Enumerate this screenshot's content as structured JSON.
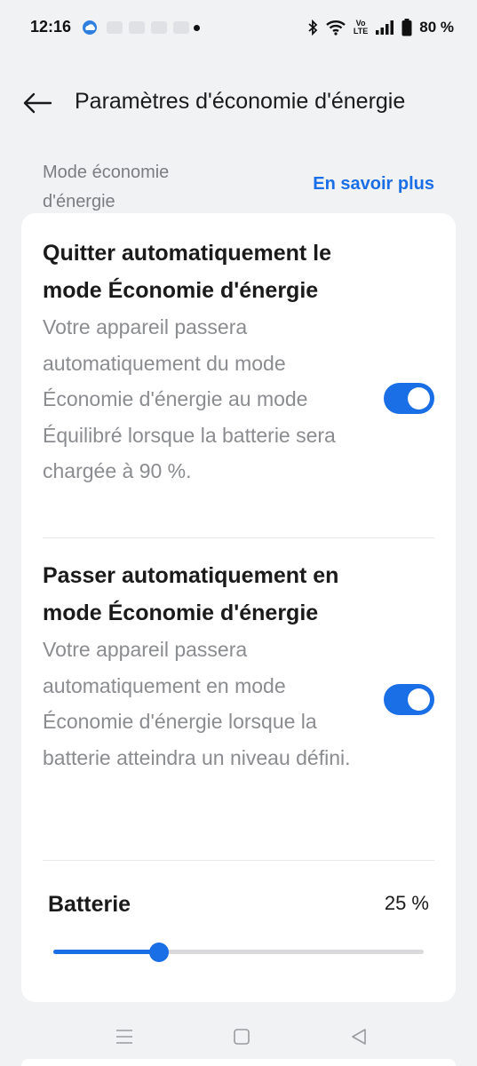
{
  "status_bar": {
    "time": "12:16",
    "volte_top": "Vo",
    "volte_bottom": "LTE",
    "battery_percent": "80 %",
    "icons": [
      "weather-icon",
      "bluetooth-icon",
      "wifi-icon",
      "signal-icon",
      "battery-icon"
    ]
  },
  "header": {
    "title": "Paramètres d'économie d'énergie"
  },
  "section": {
    "label": "Mode économie d'énergie",
    "link": "En savoir plus"
  },
  "settings": [
    {
      "title": "Quitter automatiquement le mode Économie d'énergie",
      "description": "Votre appareil passera automatiquement du mode Économie d'énergie au mode Équilibré lorsque la batterie sera chargée à 90 %.",
      "enabled": true
    },
    {
      "title": "Passer automatiquement en mode Économie d'énergie",
      "description": "Votre appareil passera automatiquement en mode Économie d'énergie lorsque la batterie atteindra un niveau défini.",
      "enabled": true
    }
  ],
  "battery_threshold": {
    "label": "Batterie",
    "value_text": "25 %",
    "slider_fraction": 0.286
  },
  "colors": {
    "accent": "#1a6ee6",
    "background": "#f1f2f4",
    "card": "#ffffff",
    "secondary_text": "#8a8c8f"
  }
}
